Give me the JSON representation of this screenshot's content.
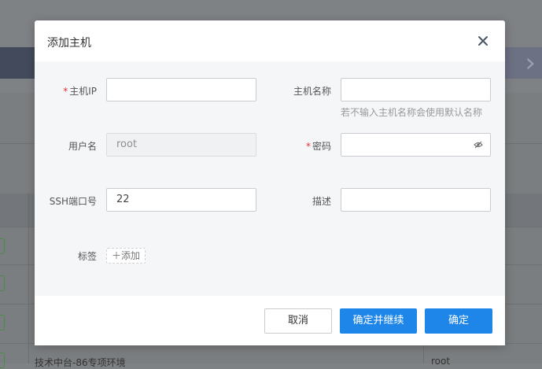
{
  "background": {
    "row_text": "技术中台-86专项环境",
    "row_user": "root"
  },
  "dialog": {
    "title": "添加主机",
    "close_icon": "close-icon",
    "fields": {
      "host_ip": {
        "label": "主机IP",
        "required": true,
        "value": ""
      },
      "host_name": {
        "label": "主机名称",
        "required": false,
        "value": "",
        "hint": "若不输入主机名称会使用默认名称"
      },
      "username": {
        "label": "用户名",
        "value": "root",
        "disabled": true
      },
      "password": {
        "label": "密码",
        "required": true,
        "value": "",
        "icon": "eye-hidden-icon"
      },
      "ssh_port": {
        "label": "SSH端口号",
        "value": "22"
      },
      "description": {
        "label": "描述",
        "value": ""
      },
      "tags": {
        "label": "标签",
        "add_label": "添加"
      }
    },
    "buttons": {
      "cancel": "取消",
      "confirm_continue": "确定并继续",
      "confirm": "确定"
    }
  },
  "colors": {
    "primary": "#1f86e9",
    "required": "#e0332f"
  }
}
